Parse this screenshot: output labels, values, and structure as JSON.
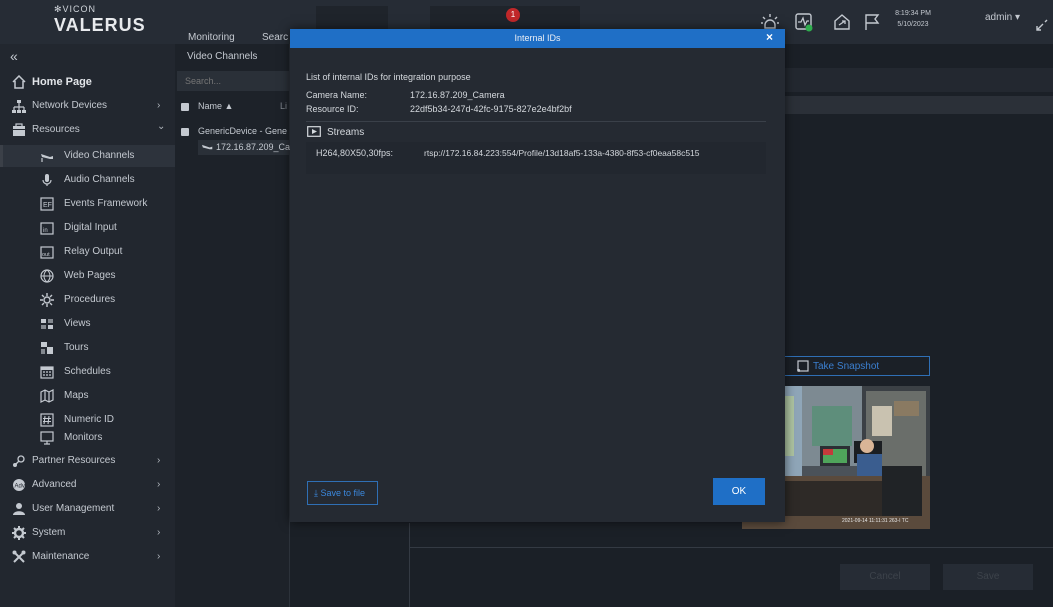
{
  "app": {
    "logo_top": "✻VICON",
    "logo_bottom": "VALERUS",
    "nav": [
      "Monitoring",
      "Searc"
    ],
    "notifications": "1",
    "time": "8:19:34 PM",
    "date": "5/10/2023",
    "user": "admin ▾",
    "collapse_glyph": "«"
  },
  "sidebar": {
    "items": [
      {
        "label": "Home Page",
        "icon": "home-icon",
        "chevron": ""
      },
      {
        "label": "Network Devices",
        "icon": "network-icon",
        "chevron": "›"
      },
      {
        "label": "Resources",
        "icon": "resources-icon",
        "chevron": "⌄"
      },
      {
        "label": "Video Channels",
        "icon": "camera-icon",
        "chevron": ""
      },
      {
        "label": "Audio Channels",
        "icon": "microphone-icon",
        "chevron": ""
      },
      {
        "label": "Events Framework",
        "icon": "events-icon",
        "chevron": ""
      },
      {
        "label": "Digital Input",
        "icon": "digital-input-icon",
        "chevron": ""
      },
      {
        "label": "Relay Output",
        "icon": "relay-output-icon",
        "chevron": ""
      },
      {
        "label": "Web Pages",
        "icon": "globe-icon",
        "chevron": ""
      },
      {
        "label": "Procedures",
        "icon": "procedures-icon",
        "chevron": ""
      },
      {
        "label": "Views",
        "icon": "views-icon",
        "chevron": ""
      },
      {
        "label": "Tours",
        "icon": "tours-icon",
        "chevron": ""
      },
      {
        "label": "Schedules",
        "icon": "calendar-icon",
        "chevron": ""
      },
      {
        "label": "Maps",
        "icon": "map-icon",
        "chevron": ""
      },
      {
        "label": "Numeric ID",
        "icon": "numeric-id-icon",
        "chevron": ""
      },
      {
        "label": "Monitors",
        "icon": "monitor-icon",
        "chevron": ""
      },
      {
        "label": "Partner Resources",
        "icon": "partner-icon",
        "chevron": "›"
      },
      {
        "label": "Advanced",
        "icon": "advanced-icon",
        "chevron": "›"
      },
      {
        "label": "User Management",
        "icon": "user-icon",
        "chevron": "›"
      },
      {
        "label": "System",
        "icon": "gear-icon",
        "chevron": "›"
      },
      {
        "label": "Maintenance",
        "icon": "tools-icon",
        "chevron": "›"
      }
    ]
  },
  "middle": {
    "title": "Video Channels",
    "search_placeholder": "Search...",
    "col_name": "Name ▲",
    "col_partial": "Li",
    "group": "GenericDevice - Gene",
    "camera": "172.16.87.209_Ca"
  },
  "right": {
    "snapshot": "Take Snapshot",
    "cancel": "Cancel",
    "save": "Save",
    "timestamp": "2021-09-14 11:11:31 263-I TC"
  },
  "modal": {
    "title": "Internal IDs",
    "close": "×",
    "intro": "List of internal IDs for integration purpose",
    "camera_name_label": "Camera Name:",
    "camera_name_value": "172.16.87.209_Camera",
    "resource_id_label": "Resource ID:",
    "resource_id_value": "22df5b34-247d-42fc-9175-827e2e4bf2bf",
    "streams_label": "Streams",
    "stream_format": "H264,80X50,30fps:",
    "stream_url": "rtsp://172.16.84.223:554/Profile/13d18af5-133a-4380-8f53-cf0eaa58c515",
    "save_file": "⤓ Save to file",
    "ok": "OK"
  },
  "colors": {
    "accent": "#1f6fc6",
    "badge": "#c0282a",
    "bg": "#1c2129"
  }
}
